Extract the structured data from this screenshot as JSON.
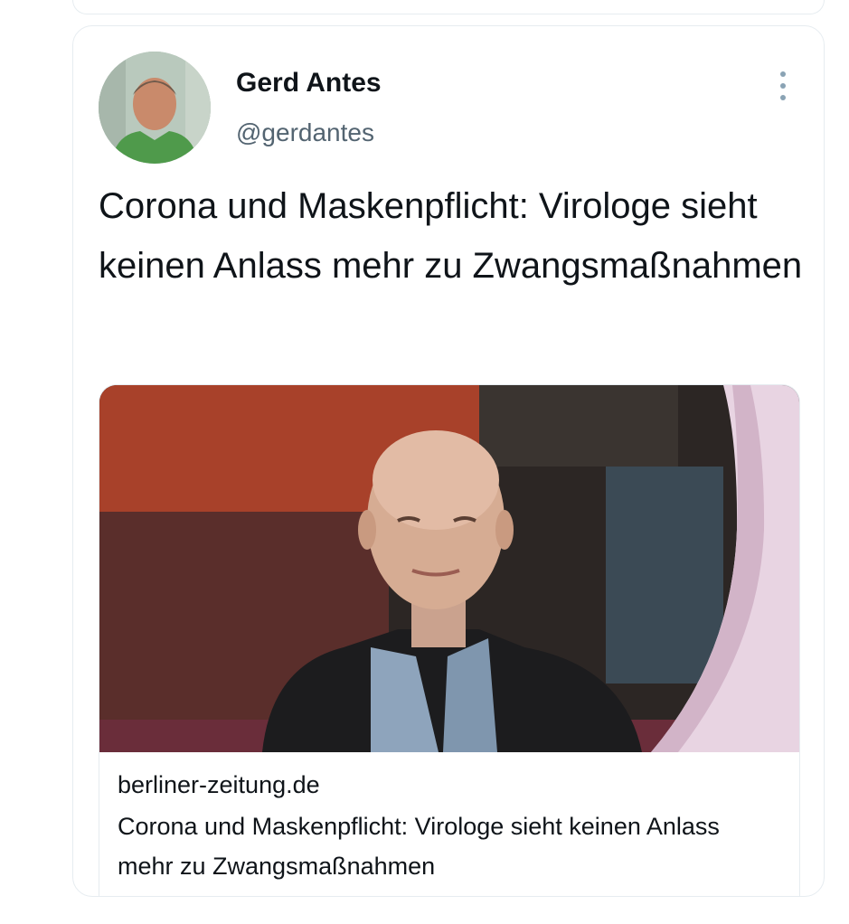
{
  "tweet": {
    "author": {
      "display_name": "Gerd Antes",
      "handle": "@gerdantes",
      "avatar_icon": "user-photo"
    },
    "more_icon": "more-vertical-icon",
    "text": "Corona und Maskenpflicht: Virologe sieht keinen Anlass mehr zu Zwangsmaßnahmen",
    "link_card": {
      "domain": "berliner-zeitung.de",
      "title": "Corona und Maskenpflicht: Virologe sieht keinen Anlass mehr zu Zwangsmaßnahmen"
    }
  },
  "colors": {
    "text_primary": "#0f1419",
    "text_secondary": "#536471",
    "border": "#e6ecf0",
    "more_icon": "#8aa3b4"
  }
}
